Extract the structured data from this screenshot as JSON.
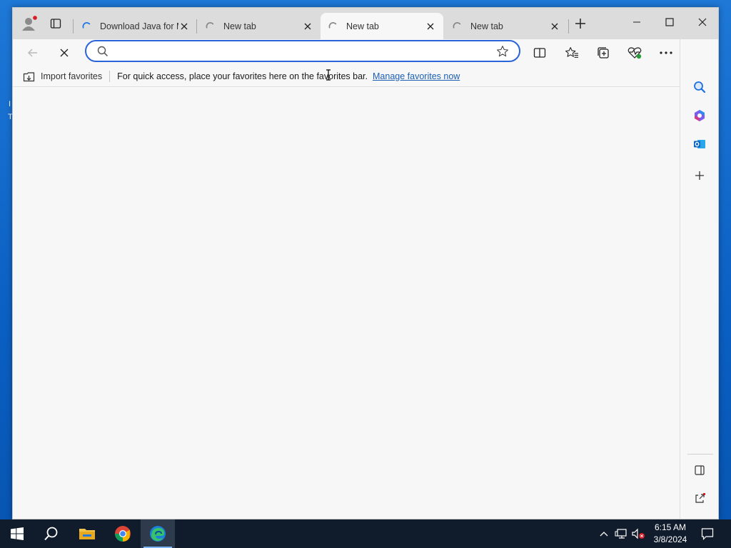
{
  "tabs": [
    {
      "title": "Download Java for M",
      "active": false,
      "loading_color": "#1a73e8"
    },
    {
      "title": "New tab",
      "active": false,
      "loading_color": "#888888"
    },
    {
      "title": "New tab",
      "active": true,
      "loading_color": "#888888"
    },
    {
      "title": "New tab",
      "active": false,
      "loading_color": "#888888"
    }
  ],
  "address_bar": {
    "value": "",
    "placeholder": ""
  },
  "favorites_bar": {
    "import_label": "Import favorites",
    "message": "For quick access, place your favorites here on the favorites bar.",
    "manage_link": "Manage favorites now"
  },
  "taskbar": {
    "time": "6:15 AM",
    "date": "3/8/2024"
  },
  "colors": {
    "accent": "#2b63d8",
    "link": "#1a5fb4",
    "taskbar": "#101c2c"
  },
  "icons": {
    "profile": "profile-icon",
    "workspaces": "tab-actions-icon",
    "refresh_stop": "stop-loading-icon",
    "back": "back-arrow-icon",
    "split_screen": "split-screen-icon",
    "favorites": "favorites-star-icon",
    "collections": "collections-icon",
    "performance": "browser-essentials-icon",
    "more": "more-icon",
    "copilot": "bing-copilot-icon"
  }
}
